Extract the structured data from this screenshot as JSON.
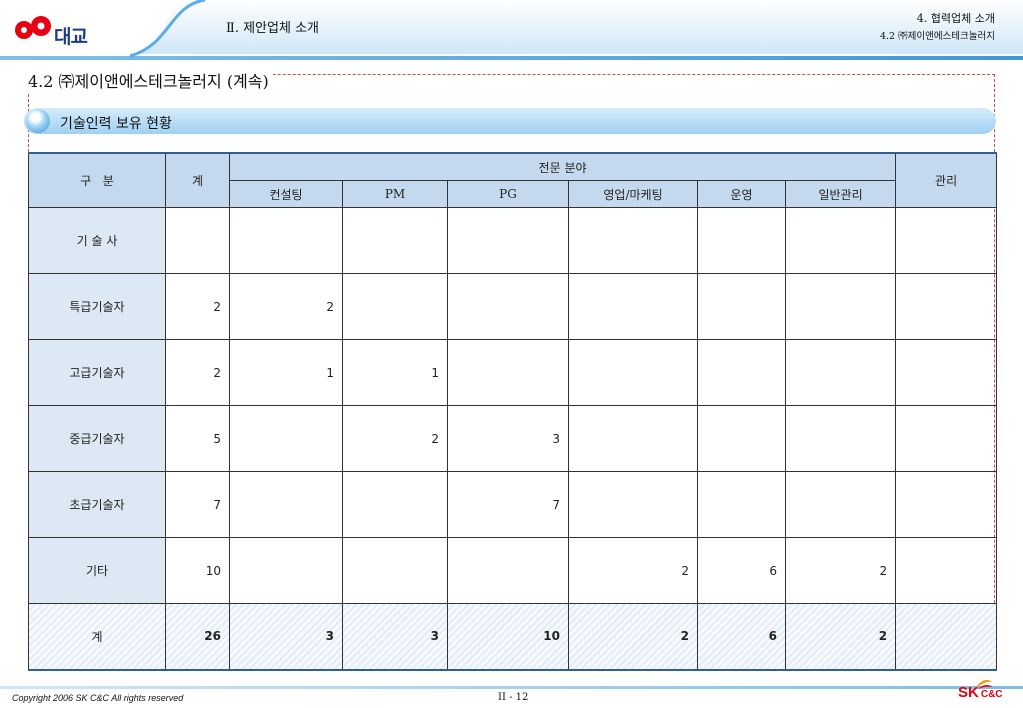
{
  "header": {
    "logo_text": "대교",
    "title": "Ⅱ. 제안업체 소개",
    "right_line1": "4. 협력업체 소개",
    "right_line2": "4.2 ㈜제이앤에스테크놀러지"
  },
  "section_title": "4.2 ㈜제이앤에스테크놀러지 (계속)",
  "sub_banner_label": "기술인력 보유 현황",
  "table": {
    "header": {
      "category": "구   분",
      "total": "계",
      "group": "전문 분야",
      "management": "관리",
      "fields": [
        "컨설팅",
        "PM",
        "PG",
        "영업/마케팅",
        "운영",
        "일반관리"
      ]
    },
    "rows": [
      {
        "label": "기 술 사",
        "cells": [
          "",
          "",
          "",
          "",
          "",
          "",
          "",
          ""
        ]
      },
      {
        "label": "특급기술자",
        "cells": [
          "2",
          "2",
          "",
          "",
          "",
          "",
          "",
          ""
        ]
      },
      {
        "label": "고급기술자",
        "cells": [
          "2",
          "1",
          "1",
          "",
          "",
          "",
          "",
          ""
        ]
      },
      {
        "label": "중급기술자",
        "cells": [
          "5",
          "",
          "2",
          "3",
          "",
          "",
          "",
          ""
        ]
      },
      {
        "label": "초급기술자",
        "cells": [
          "7",
          "",
          "",
          "7",
          "",
          "",
          "",
          ""
        ]
      },
      {
        "label": "기타",
        "cells": [
          "10",
          "",
          "",
          "",
          "2",
          "6",
          "2",
          ""
        ]
      },
      {
        "label": "계",
        "cells": [
          "26",
          "3",
          "3",
          "10",
          "2",
          "6",
          "2",
          ""
        ]
      }
    ]
  },
  "footer": {
    "copyright": "Copyright 2006 SK C&C All rights reserved",
    "page": "II - 12",
    "brand_sk": "SK",
    "brand_cc": "C&C"
  },
  "colors": {
    "header_fill": "#c5d9ee",
    "category_fill": "#dce8f4",
    "accent_blue": "#2e5f8e",
    "brand_red": "#e60012",
    "frame_dash": "#c0504d"
  }
}
